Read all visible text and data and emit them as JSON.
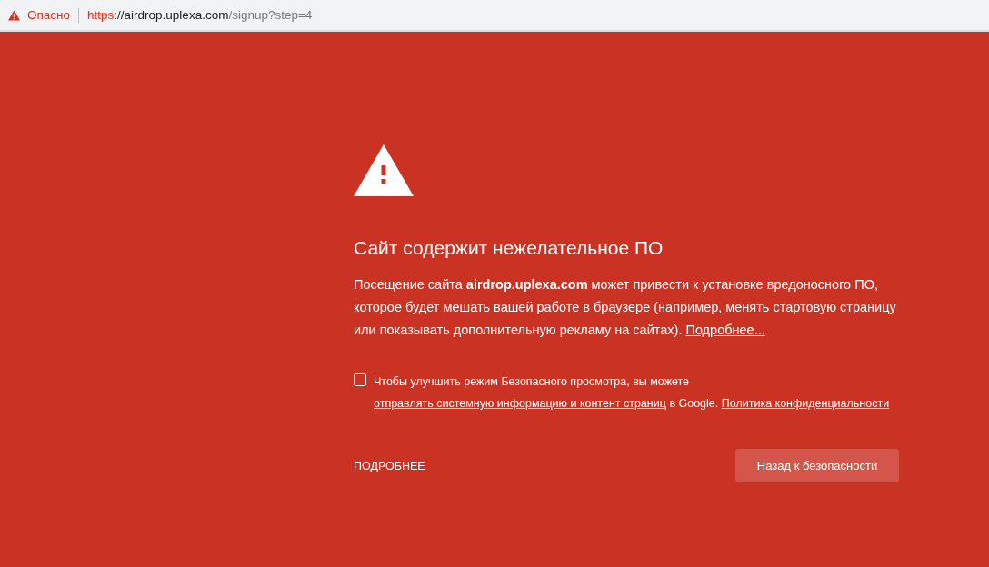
{
  "address_bar": {
    "security_label": "Опасно",
    "scheme": "https",
    "host": "://airdrop.uplexa.com",
    "path": "/signup?step=4"
  },
  "heading": "Сайт содержит нежелательное ПО",
  "description": {
    "text": "Посещение сайта **airdrop.uplexa.com** может привести к установке вредоносного ПО, которое будет мешать вашей работе в браузере (например, менять стартовую страницу или показывать дополнительную рекламу на сайтах).",
    "link": "Подробнее..."
  },
  "report_option": {
    "checked": false,
    "text": "Чтобы улучшить режим Безопасного просмотра, вы можете",
    "link": "отправлять системную информацию и контент страниц",
    "text_after": "в Google.",
    "policy_link": "Политика конфиденциальности"
  },
  "details_button": "ПОДРОБНЕЕ",
  "back_button": "Назад к безопасности"
}
